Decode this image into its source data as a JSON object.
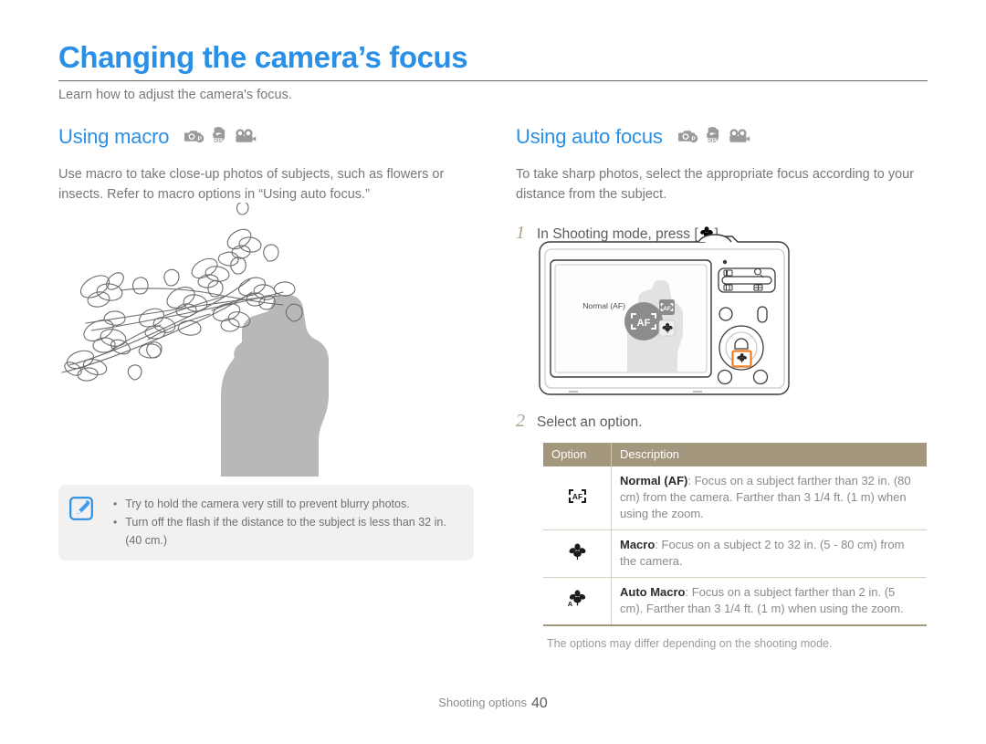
{
  "header": {
    "title": "Changing the camera’s focus",
    "intro": "Learn how to adjust the camera's focus."
  },
  "left_section": {
    "heading": "Using macro",
    "mode_icons": [
      "camera-p-mode-icon",
      "dis-mode-icon",
      "movie-mode-icon"
    ],
    "body": "Use macro to take close-up photos of subjects, such as flowers or insects. Refer to macro options in “Using auto focus.”",
    "illustration": "magnolia-branch-photographer-illustration"
  },
  "right_section": {
    "heading": "Using auto focus",
    "mode_icons": [
      "camera-p-mode-icon",
      "dis-mode-icon",
      "movie-mode-icon"
    ],
    "body": "To take sharp photos, select the appropriate focus according to your distance from the subject.",
    "steps": [
      {
        "num": "1",
        "text_before": "In Shooting mode, press [",
        "icon": "macro-flower-icon",
        "text_after": "]."
      },
      {
        "num": "2",
        "text_before": "Select an option.",
        "icon": "",
        "text_after": ""
      }
    ],
    "camera_illustration": {
      "name": "camera-back-illustration",
      "lcd_label": "Normal (AF)",
      "lcd_icons": [
        "af-icon",
        "auto-macro-icon",
        "macro-flower-icon"
      ],
      "highlighted_button": "macro-button"
    },
    "table": {
      "columns": [
        "Option",
        "Description"
      ],
      "rows": [
        {
          "icon": "af-icon",
          "name": "Normal (AF)",
          "description": ": Focus on a subject farther than 32 in. (80 cm) from the camera. Farther than 3 1/4 ft. (1 m) when using the zoom."
        },
        {
          "icon": "macro-flower-icon",
          "name": "Macro",
          "description": ": Focus on a subject 2 to 32 in. (5 - 80 cm) from the camera."
        },
        {
          "icon": "auto-macro-icon",
          "name": "Auto Macro",
          "description": ": Focus on a subject farther than 2 in. (5 cm). Farther than 3 1/4 ft. (1 m) when using the zoom."
        }
      ],
      "footnote": "The options may differ depending on the shooting mode."
    }
  },
  "tip_box": {
    "icon": "note-pen-icon",
    "items": [
      "Try to hold the camera very still to prevent blurry photos.",
      "Turn off the flash if the distance to the subject is less than 32 in. (40 cm.)"
    ]
  },
  "footer": {
    "section": "Shooting options",
    "page": "40"
  },
  "colors": {
    "accent_blue": "#2a8fe6",
    "table_header": "#a3977e",
    "tip_bg": "#f2f1ef",
    "highlight_orange": "#f07c22"
  }
}
